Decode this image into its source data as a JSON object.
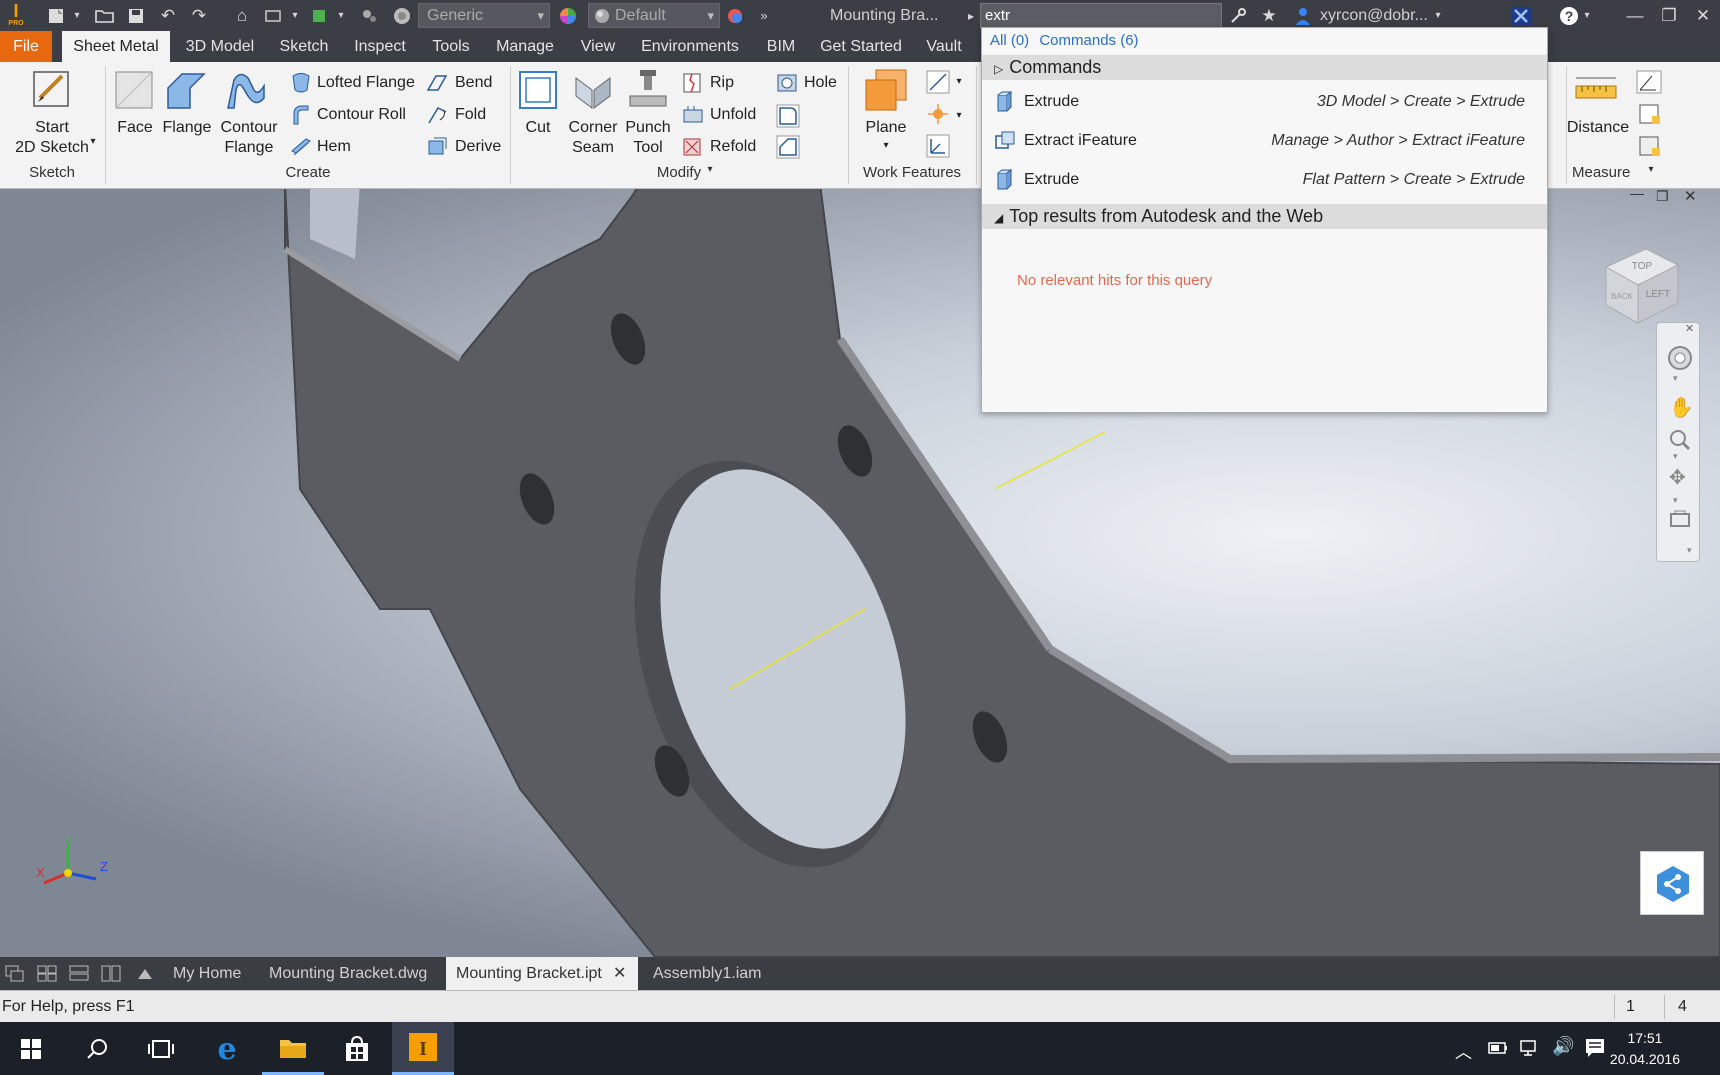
{
  "title_bar": {
    "appearance_dropdown": "Generic",
    "material_dropdown": "Default",
    "document_title": "Mounting Bra...",
    "search_query": "extr",
    "user": "xyrcon@dobr..."
  },
  "menu": {
    "tabs": [
      "File",
      "Sheet Metal",
      "3D Model",
      "Sketch",
      "Inspect",
      "Tools",
      "Manage",
      "View",
      "Environments",
      "BIM",
      "Get Started",
      "Vault"
    ]
  },
  "ribbon": {
    "sketch_panel": {
      "label": "Sketch",
      "start_sketch_line1": "Start",
      "start_sketch_line2": "2D Sketch"
    },
    "create_panel": {
      "label": "Create",
      "face": "Face",
      "flange": "Flange",
      "contour_flange_line1": "Contour",
      "contour_flange_line2": "Flange",
      "lofted_flange": "Lofted Flange",
      "contour_roll": "Contour Roll",
      "hem": "Hem",
      "bend": "Bend",
      "fold": "Fold",
      "derive": "Derive"
    },
    "modify_panel": {
      "label": "Modify",
      "cut": "Cut",
      "corner_seam_line1": "Corner",
      "corner_seam_line2": "Seam",
      "punch_tool_line1": "Punch",
      "punch_tool_line2": "Tool",
      "rip": "Rip",
      "unfold": "Unfold",
      "refold": "Refold",
      "hole": "Hole"
    },
    "work_features_panel": {
      "label": "Work Features",
      "plane": "Plane"
    },
    "measure_panel": {
      "label": "Measure",
      "distance": "Distance"
    }
  },
  "search_results": {
    "filter_all": "All (0)",
    "filter_commands": "Commands (6)",
    "commands_header": "Commands",
    "results": [
      {
        "name": "Extrude",
        "path": "3D Model > Create > Extrude"
      },
      {
        "name": "Extract iFeature",
        "path": "Manage > Author > Extract iFeature"
      },
      {
        "name": "Extrude",
        "path": "Flat Pattern > Create > Extrude"
      }
    ],
    "web_header": "Top results from Autodesk and the Web",
    "no_hits": "No relevant hits for this query"
  },
  "viewcube": {
    "face_top": "TOP",
    "face_left": "LEFT",
    "face_back": "BACK"
  },
  "triad": {
    "x": "X",
    "y": "Y",
    "z": "Z"
  },
  "document_tabs": [
    "My Home",
    "Mounting Bracket.dwg",
    "Mounting Bracket.ipt",
    "Assembly1.iam"
  ],
  "status_bar": {
    "help_text": "For Help, press F1",
    "count1": "1",
    "count2": "4"
  },
  "taskbar": {
    "time": "17:51",
    "date": "20.04.2016"
  },
  "colors": {
    "accent_orange": "#e8680f",
    "dark_chrome": "#3b3e44",
    "ribbon_bg": "#f3f3f3",
    "part_gray": "#5a5c62",
    "no_hits": "#e06a4f",
    "link_blue": "#2c6fc7"
  }
}
